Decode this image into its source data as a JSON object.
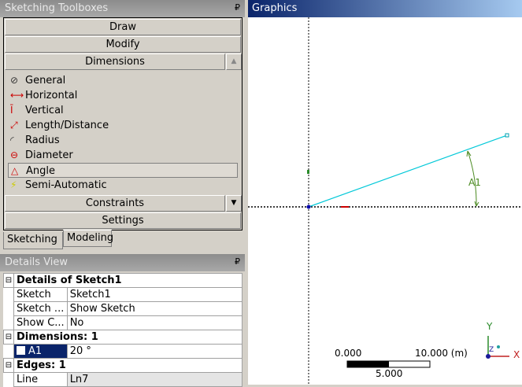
{
  "toolbox": {
    "title": "Sketching Toolboxes",
    "sections": {
      "draw": "Draw",
      "modify": "Modify",
      "dimensions": "Dimensions",
      "constraints": "Constraints",
      "settings": "Settings"
    },
    "items": [
      "General",
      "Horizontal",
      "Vertical",
      "Length/Distance",
      "Radius",
      "Diameter",
      "Angle",
      "Semi-Automatic"
    ],
    "selected": "Angle",
    "tabs": [
      "Sketching",
      "Modeling"
    ]
  },
  "details": {
    "title": "Details View",
    "groups": [
      {
        "title": "Details of Sketch1",
        "rows": [
          [
            "Sketch",
            "Sketch1"
          ],
          [
            "Sketch ...",
            "Show Sketch"
          ],
          [
            "Show C...",
            "No"
          ]
        ]
      },
      {
        "title": "Dimensions: 1",
        "rows": [
          [
            "A1",
            "20 °"
          ]
        ]
      },
      {
        "title": "Edges: 1",
        "rows": [
          [
            "Line",
            "Ln7"
          ]
        ]
      }
    ]
  },
  "graphics": {
    "title": "Graphics",
    "dimension_label": "A1",
    "scale": {
      "start": "0.000",
      "end": "10.000 (m)",
      "mid": "5.000"
    },
    "axes": {
      "x": "X",
      "y": "Y",
      "z": "Z"
    }
  },
  "colors": {
    "sketch_line": "#00c8d8",
    "dimension": "#4a8a20",
    "selection": "#0a246a"
  }
}
